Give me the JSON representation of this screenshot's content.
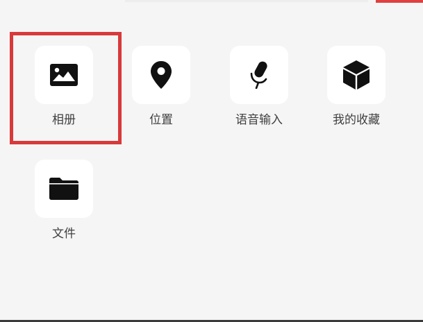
{
  "panel": {
    "items": [
      {
        "label": "相册",
        "icon": "image-icon"
      },
      {
        "label": "位置",
        "icon": "location-pin-icon"
      },
      {
        "label": "语音输入",
        "icon": "microphone-icon"
      },
      {
        "label": "我的收藏",
        "icon": "cube-icon"
      },
      {
        "label": "文件",
        "icon": "folder-icon"
      }
    ],
    "selected_index": 0
  },
  "colors": {
    "background": "#f5f5f5",
    "tile": "#ffffff",
    "icon": "#111111",
    "label": "#3f3f3f",
    "highlight": "#d8393a"
  }
}
